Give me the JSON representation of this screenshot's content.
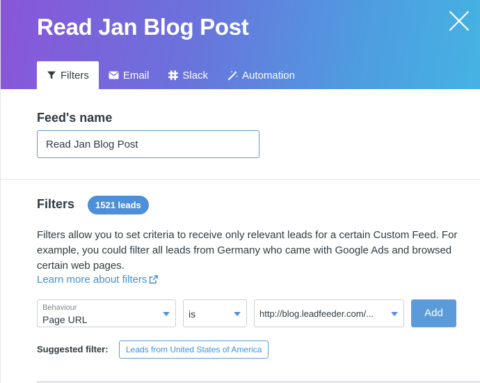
{
  "modal": {
    "title": "Read Jan Blog Post"
  },
  "tabs": [
    {
      "label": "Filters",
      "icon": "filter-icon",
      "active": true
    },
    {
      "label": "Email",
      "icon": "envelope-icon",
      "active": false
    },
    {
      "label": "Slack",
      "icon": "slack-icon",
      "active": false
    },
    {
      "label": "Automation",
      "icon": "magic-wand-icon",
      "active": false
    }
  ],
  "feed_name": {
    "label": "Feed's name",
    "value": "Read Jan Blog Post"
  },
  "filters": {
    "heading": "Filters",
    "leads_badge": "1521 leads",
    "description": "Filters allow you to set criteria to receive only relevant leads for a certain Custom Feed. For example, you could filter all leads from Germany who came with Google Ads and browsed certain web pages.",
    "learn_more": "Learn more about filters",
    "rule": {
      "category_label": "Behaviour",
      "category_value": "Page URL",
      "operator": "is",
      "value": "http://blog.leadfeeder.com/...",
      "add_button": "Add"
    },
    "suggested_label": "Suggested filter:",
    "suggested_chip": "Leads from United States of America"
  },
  "colors": {
    "header_gradient_start": "#8a55d9",
    "header_gradient_end": "#45b3e3",
    "accent": "#5b9bd9",
    "link": "#3f8fd6"
  }
}
